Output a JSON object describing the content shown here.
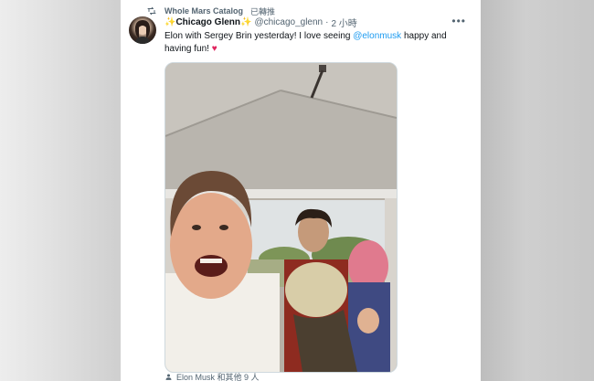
{
  "retweet": {
    "name": "Whole Mars Catalog",
    "suffix": "已轉推"
  },
  "tweet": {
    "display_name": "Chicago Glenn",
    "handle": "@chicago_glenn",
    "separator": "·",
    "time": "2 小時",
    "text_before": "Elon with Sergey Brin yesterday! I love seeing ",
    "mention": "@elonmusk",
    "text_after": " happy and having fun! ",
    "emoji": "♥"
  },
  "media": {
    "tagged": "Elon Musk 和其他 9 人"
  },
  "icons": {
    "retweet": "retweet-icon",
    "more": "more-icon",
    "sparkle": "sparkle-icon",
    "heart": "heart-emoji",
    "person": "person-tag-icon"
  },
  "colors": {
    "accent": "#1d9bf0",
    "heart": "#e0245e",
    "sparkle": "#f0b800",
    "text_secondary": "#536471"
  }
}
